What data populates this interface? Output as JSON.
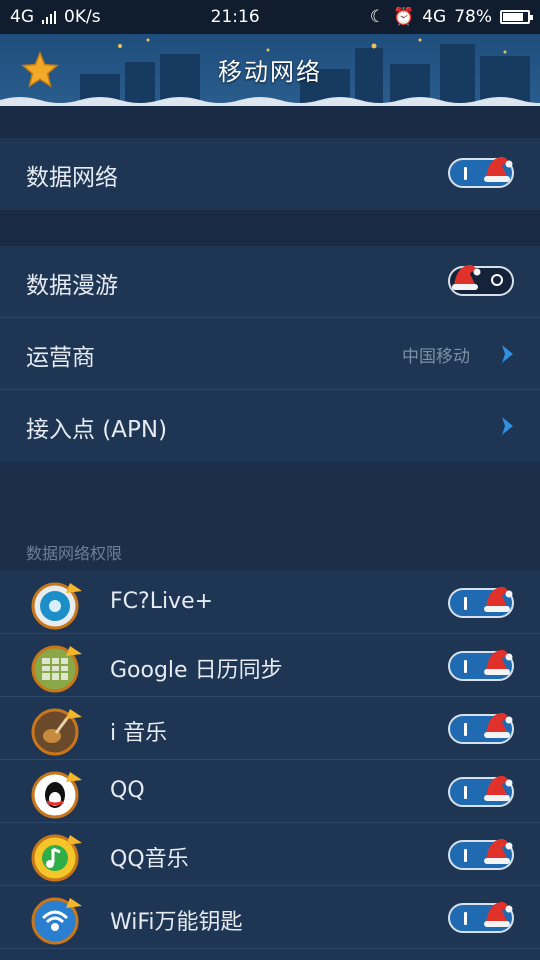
{
  "status_bar": {
    "network": "4G",
    "speed": "0K/s",
    "time": "21:16",
    "network_type": "4G",
    "battery_percent": "78%",
    "battery_level": 0.78
  },
  "header": {
    "title": "移动网络"
  },
  "settings": {
    "data_network": {
      "label": "数据网络",
      "enabled": true
    },
    "data_roaming": {
      "label": "数据漫游",
      "enabled": false
    },
    "carrier": {
      "label": "运营商",
      "value": "中国移动"
    },
    "apn": {
      "label": "接入点 (APN)"
    }
  },
  "permissions": {
    "caption": "数据网络权限",
    "apps": [
      {
        "name": "FC?Live+",
        "enabled": true
      },
      {
        "name": "Google 日历同步",
        "enabled": true
      },
      {
        "name": "i 音乐",
        "enabled": true
      },
      {
        "name": "QQ",
        "enabled": true
      },
      {
        "name": "QQ音乐",
        "enabled": true
      },
      {
        "name": "WiFi万能钥匙",
        "enabled": true
      }
    ]
  },
  "colors": {
    "toggle_on": "#1f6ab0",
    "toggle_off": "#14233a",
    "hat_red": "#e0312b",
    "chevron_blue": "#2f8fe0"
  }
}
